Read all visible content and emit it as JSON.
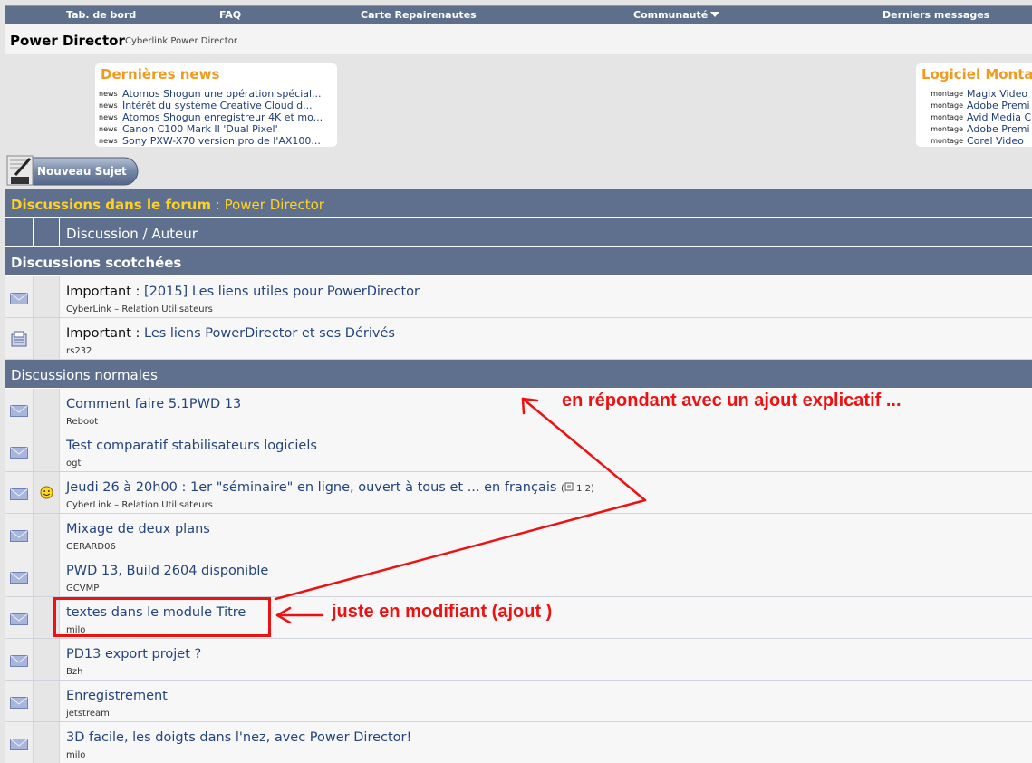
{
  "nav": {
    "dashboard": "Tab. de bord",
    "faq": "FAQ",
    "map": "Carte Repairenautes",
    "community": "Communauté",
    "latest": "Derniers messages"
  },
  "forum": {
    "title": "Power Director",
    "subtitle": "Cyberlink Power Director"
  },
  "news": {
    "title": "Dernières news",
    "tag": "news",
    "items": [
      "Atomos Shogun une opération spécial...",
      "Intérêt du système Creative Cloud d...",
      "Atomos Shogun enregistreur 4K et mo...",
      "Canon C100 Mark II 'Dual Pixel'",
      "Sony PXW-X70 version pro de l'AX100..."
    ]
  },
  "software": {
    "title": "Logiciel Montag",
    "tag": "montage",
    "items": [
      "Magix Video",
      "Adobe Premi",
      "Avid Media C",
      "Adobe Premi",
      "Corel Video"
    ]
  },
  "new_topic_button": "Nouveau Sujet",
  "header": {
    "forum_label": "Discussions dans le forum",
    "forum_sep": " : ",
    "forum_name": "Power Director",
    "column": "Discussion / Auteur",
    "sticky": "Discussions scotchées",
    "normal": "Discussions normales"
  },
  "sticky_threads": [
    {
      "prefix": "Important : ",
      "title": "[2015] Les liens utiles pour PowerDirector",
      "author": "CyberLink – Relation Utilisateurs"
    },
    {
      "prefix": "Important : ",
      "title": "Les liens PowerDirector et ses Dérivés",
      "author": "rs232"
    }
  ],
  "threads": [
    {
      "title": "Comment faire 5.1PWD 13",
      "author": "Reboot"
    },
    {
      "title": "Test comparatif stabilisateurs logiciels",
      "author": "ogt"
    },
    {
      "title": "Jeudi 26 à 20h00 : 1er \"séminaire\" en ligne, ouvert à tous et ... en français",
      "author": "CyberLink – Relation Utilisateurs",
      "pages": "1 2"
    },
    {
      "title": "Mixage de deux plans",
      "author": "GERARD06"
    },
    {
      "title": "PWD 13, Build 2604 disponible",
      "author": "GCVMP"
    },
    {
      "title": "textes dans le module Titre",
      "author": "milo"
    },
    {
      "title": "PD13 export projet ?",
      "author": "Bzh"
    },
    {
      "title": "Enregistrement",
      "author": "jetstream"
    },
    {
      "title": "3D facile, les doigts dans l'nez, avec Power Director!",
      "author": "milo"
    }
  ],
  "annotations": {
    "top": "en répondant avec un ajout explicatif ...",
    "bottom": "juste en modifiant (ajout )"
  },
  "colors": {
    "nav_bar": "#5e6f8c",
    "header_bar": "#5f708e",
    "news_title": "#f29a1f",
    "forum_label": "#ffd21f",
    "link": "#23447e",
    "annotation": "#ee1111"
  }
}
